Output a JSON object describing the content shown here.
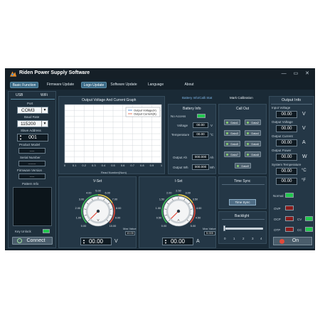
{
  "app": {
    "title": "Riden Power Supply Software",
    "window_controls": "— ▭ ✕"
  },
  "tabs": [
    "Basic Function",
    "Firmware Update",
    "Logo Update",
    "Software Update",
    "Language",
    "About"
  ],
  "connection": {
    "tabs": [
      "USB",
      "WiFi"
    ],
    "port_label": "Port",
    "port_value": "COM3",
    "baud_label": "Baud Rate",
    "baud_value": "115200",
    "slave_label": "Slave Address",
    "slave_value": "001",
    "model_label": "Product Model",
    "model_value": "-----",
    "serial_label": "Serial Number",
    "serial_value": "--------",
    "firmware_label": "Firmware Version",
    "firmware_value": "-----",
    "pattern_label": "Pattern Info",
    "key_unlock_label": "Key Unlock",
    "connect_label": "Connect"
  },
  "graph_panel": {
    "title": "Output Voltage And Current Graph",
    "legend": [
      "Output Voltage(V)",
      "Output Current(A)"
    ],
    "xlabel": "Read Number(Num)"
  },
  "chart_data": {
    "type": "line",
    "title": "Output Voltage And Current Graph",
    "xlabel": "Read Number(Num)",
    "ylabel": "",
    "x_ticks": [
      "0",
      "0.1",
      "0.2",
      "0.3",
      "0.4",
      "0.5",
      "0.6",
      "0.7",
      "0.8",
      "0.9",
      "1"
    ],
    "xlim": [
      0,
      1
    ],
    "grid": true,
    "legend_position": "top-right",
    "series": [
      {
        "name": "Output Voltage(V)",
        "values": []
      },
      {
        "name": "Output Current(A)",
        "values": []
      }
    ]
  },
  "battery": {
    "tabs": [
      "Battery Info/Calli Stat",
      "Mark Calibration"
    ],
    "title": "Battery Info",
    "no_access_label": "No Access",
    "voltage_label": "Voltage",
    "voltage_value": "00.00",
    "voltage_unit": "V",
    "temperature_label": "Temperature",
    "temperature_value": "00.00",
    "temperature_unit": "°C",
    "output_ah_label": "Output Ah",
    "output_ah_value": "000.000",
    "output_ah_unit": "Ah",
    "output_wh_label": "Output Wh",
    "output_wh_value": "000.000",
    "output_wh_unit": "Wh"
  },
  "callout": {
    "title": "Call Out",
    "buttons": [
      "Data1",
      "Data2",
      "Data3",
      "Data4",
      "Data5",
      "Data6",
      "Data7",
      "Data8",
      "Data9"
    ]
  },
  "time_sync": {
    "title": "Time Sync",
    "button": "Time Sync"
  },
  "backlight": {
    "title": "Backlight",
    "ticks": [
      "0",
      "1",
      "2",
      "3",
      "4"
    ],
    "level": 0
  },
  "vset": {
    "title": "V-Set",
    "value": "00.00",
    "unit": "V",
    "dial_labels": [
      "0.00",
      "1.00",
      "2.00",
      "3.00",
      "4.00",
      "5.00",
      "6.00",
      "7.00",
      "8.00",
      "9.00",
      "10.00"
    ],
    "dial_unit": "V",
    "max_label": "Max Value",
    "max_value": "10.00"
  },
  "iset": {
    "title": "I-Set",
    "value": "00.00",
    "unit": "A",
    "dial_labels": [
      "0.00",
      "0.50",
      "1.00",
      "1.50",
      "2.00",
      "2.50",
      "3.00",
      "3.50",
      "4.00",
      "4.50",
      "5.00"
    ],
    "dial_unit": "A",
    "max_label": "Max Value",
    "max_value": "5.000"
  },
  "output_info": {
    "title": "Output Info",
    "input_voltage_label": "Input Voltage",
    "input_voltage_value": "00.00",
    "input_voltage_unit": "V",
    "output_voltage_label": "Output Voltage",
    "output_voltage_value": "00.00",
    "output_voltage_unit": "V",
    "output_current_label": "Output Current",
    "output_current_value": "00.00",
    "output_current_unit": "A",
    "output_power_label": "Output Power",
    "output_power_value": "00.00",
    "output_power_unit": "W",
    "system_temp_label": "System Temperature",
    "system_temp_value": "00.00",
    "system_temp_unit": "°C",
    "temp_f_value": "00.00",
    "temp_f_unit": "°F",
    "normal_label": "Normal",
    "ovp_label": "OVP",
    "ocp_label": "OCP",
    "otp_label": "OTP",
    "cv_label": "CV",
    "cc_label": "CC",
    "on_label": "On"
  },
  "colors": {
    "background": "#1a2a36",
    "panel": "#243746",
    "accent": "#3b6a86",
    "indicator_green": "#22c84e",
    "indicator_red": "#8a1c1c",
    "on_button": "#e14a3a"
  }
}
